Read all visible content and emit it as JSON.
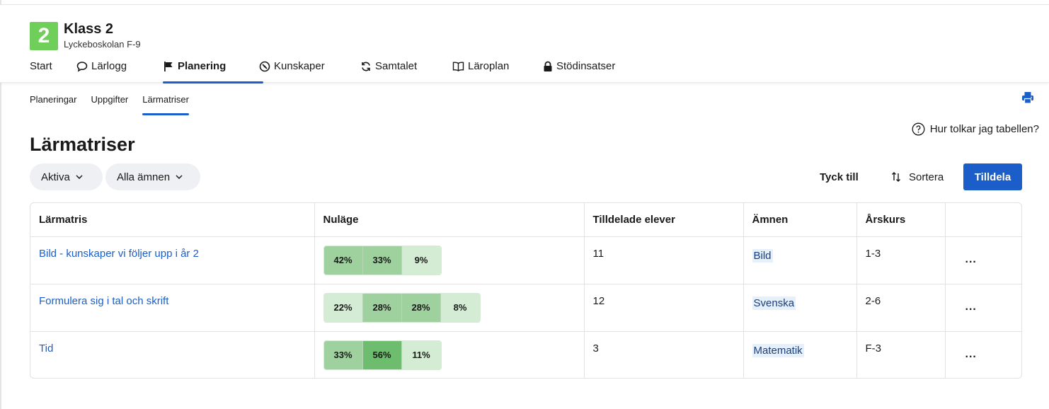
{
  "class_header": {
    "badge": "2",
    "title": "Klass 2",
    "school": "Lyckeboskolan F-9"
  },
  "main_nav": {
    "items": [
      {
        "label": "Start",
        "icon": "none",
        "active": false
      },
      {
        "label": "Lärlogg",
        "icon": "speech-bubble-icon",
        "active": false
      },
      {
        "label": "Planering",
        "icon": "flag-icon",
        "active": true
      },
      {
        "label": "Kunskaper",
        "icon": "compass-icon",
        "active": false
      },
      {
        "label": "Samtalet",
        "icon": "refresh-icon",
        "active": false
      },
      {
        "label": "Läroplan",
        "icon": "book-icon",
        "active": false
      },
      {
        "label": "Stödinsatser",
        "icon": "lock-icon",
        "active": false
      }
    ]
  },
  "sub_nav": {
    "items": [
      {
        "label": "Planeringar",
        "active": false
      },
      {
        "label": "Uppgifter",
        "active": false
      },
      {
        "label": "Lärmatriser",
        "active": true
      }
    ]
  },
  "help_link": "Hur tolkar jag tabellen?",
  "page_title": "Lärmatriser",
  "filters": {
    "status": "Aktiva",
    "subjects": "Alla ämnen"
  },
  "actions": {
    "feedback": "Tyck till",
    "sort": "Sortera",
    "assign": "Tilldela"
  },
  "table": {
    "columns": [
      "Lärmatris",
      "Nuläge",
      "Tilldelade elever",
      "Ämnen",
      "Årskurs",
      ""
    ],
    "rows": [
      {
        "name": "Bild - kunskaper vi följer upp i år 2",
        "progress": [
          "42%",
          "33%",
          "9%"
        ],
        "assigned": "11",
        "subject": "Bild",
        "grade": "1-3",
        "more": "..."
      },
      {
        "name": "Formulera sig i tal och skrift",
        "progress": [
          "22%",
          "28%",
          "28%",
          "8%"
        ],
        "assigned": "12",
        "subject": "Svenska",
        "grade": "2-6",
        "more": "..."
      },
      {
        "name": "Tid",
        "progress": [
          "33%",
          "56%",
          "11%"
        ],
        "assigned": "3",
        "subject": "Matematik",
        "grade": "F-3",
        "more": "..."
      }
    ]
  },
  "colors": {
    "accent": "#1b5ec9",
    "badge": "#6fcf5a",
    "progress_light": "#d3ecd3",
    "progress_mid": "#9fd19f",
    "progress_dark": "#6ebd6e"
  }
}
